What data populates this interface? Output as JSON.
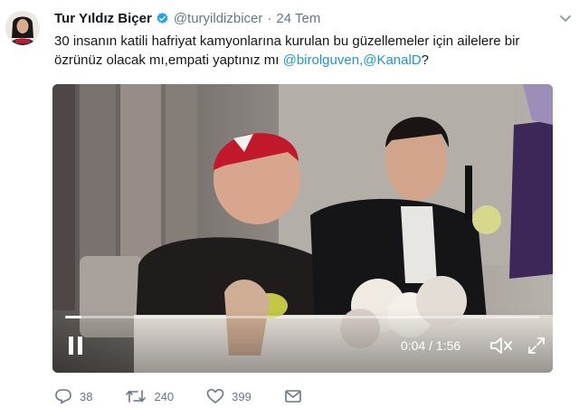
{
  "tweet": {
    "author_name": "Tur Yıldız Biçer",
    "handle": "@turyildizbicer",
    "separator": "·",
    "date": "24 Tem",
    "text_main": "30 insanın katili hafriyat kamyonlarına kurulan bu güzellemeler için ailelere bir özrünüz olacak mı,empati yaptınız mı ",
    "mention_1": "@birolguven",
    "mention_sep": ",",
    "mention_2": "@KanalD",
    "text_end": "?"
  },
  "video": {
    "elapsed": "0:04",
    "duration": "1:56",
    "time_sep": " / ",
    "progress_fraction": 0.034
  },
  "actions": {
    "replies": "38",
    "retweets": "240",
    "likes": "399"
  },
  "colors": {
    "link": "#1b95e0",
    "verified": "#1da1f2",
    "meta": "#657786"
  },
  "icons": {
    "verified": "verified-badge-icon",
    "menu": "chevron-down-icon",
    "pause": "pause-icon",
    "mute": "mute-icon",
    "fullscreen": "fullscreen-icon",
    "reply": "reply-icon",
    "retweet": "retweet-icon",
    "like": "heart-icon",
    "message": "envelope-icon"
  }
}
